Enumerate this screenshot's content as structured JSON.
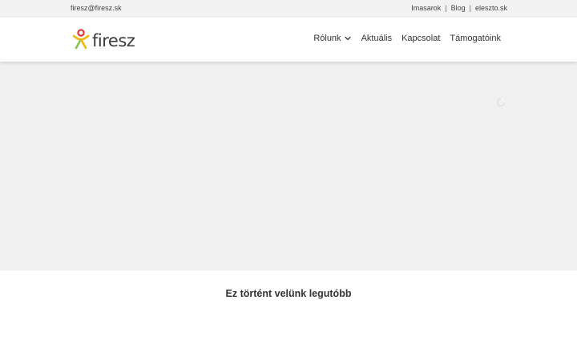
{
  "topbar": {
    "email": "firesz@firesz.sk",
    "links": [
      {
        "label": "Imasarok"
      },
      {
        "label": "Blog"
      },
      {
        "label": "eleszto.sk"
      }
    ],
    "separator": "|"
  },
  "header": {
    "logo_text": "firesz",
    "nav": [
      {
        "label": "Rólunk",
        "has_dropdown": true
      },
      {
        "label": "Aktuális"
      },
      {
        "label": "Kapcsolat"
      },
      {
        "label": "Támogatóink"
      }
    ]
  },
  "main": {
    "section_title": "Ez történt velünk legutóbb"
  },
  "colors": {
    "logo_red": "#e53935",
    "logo_yellow": "#f2b705",
    "logo_green": "#8bc34a",
    "topbar_bg": "#f2f2f2",
    "hero_bg": "#f0f0f0"
  }
}
